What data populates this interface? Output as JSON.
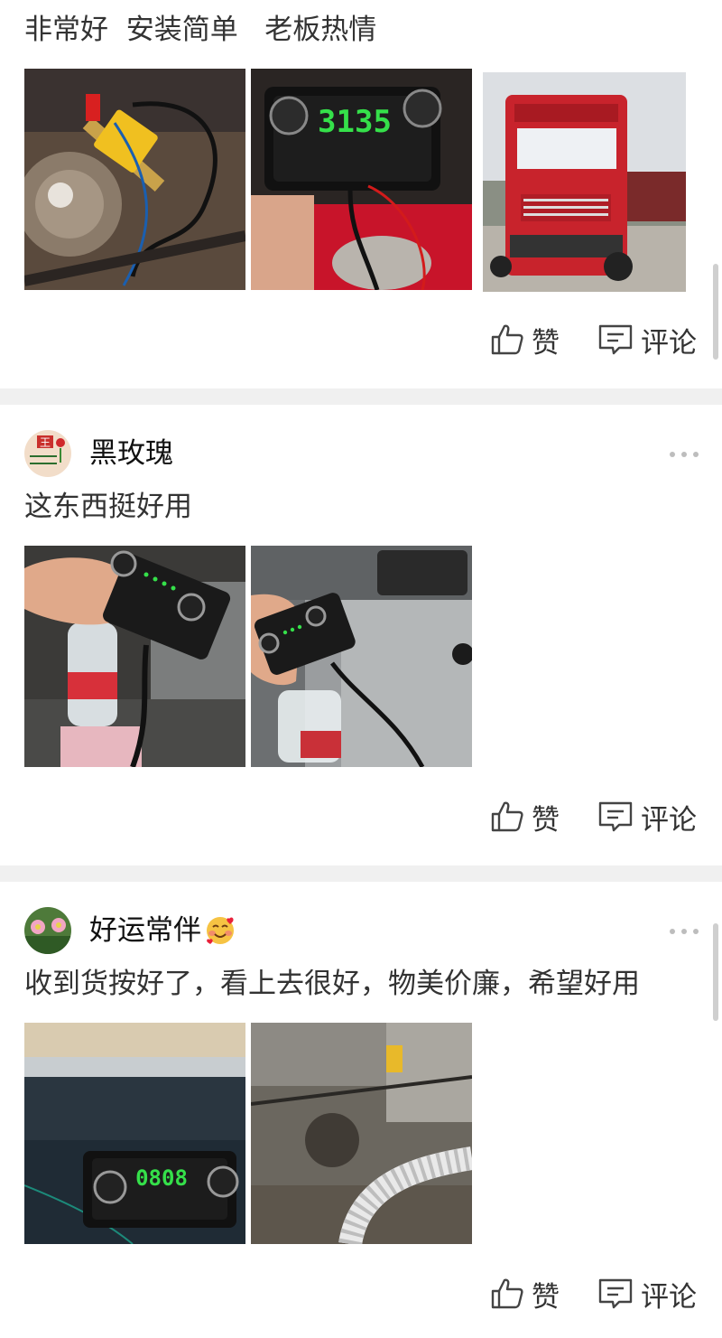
{
  "posts": [
    {
      "text": "非常好  安装简单   老板热情",
      "like_label": "赞",
      "comment_label": "评论"
    },
    {
      "author": "黑玫瑰",
      "text": "这东西挺好用",
      "like_label": "赞",
      "comment_label": "评论"
    },
    {
      "author": "好运常伴",
      "text": "收到货按好了，看上去很好，物美价廉，希望好用",
      "like_label": "赞",
      "comment_label": "评论"
    }
  ],
  "photo_displays": {
    "display_1": "3135",
    "display_2": "0808"
  },
  "icons": {
    "like": "thumbs-up-icon",
    "comment": "comment-icon",
    "more": "more-dots-icon",
    "emoji": "smiling-face-with-hearts-emoji"
  },
  "colors": {
    "text": "#222222",
    "divider": "#f0f0f0",
    "led_green": "#35e04a",
    "truck_red": "#c8232c"
  }
}
